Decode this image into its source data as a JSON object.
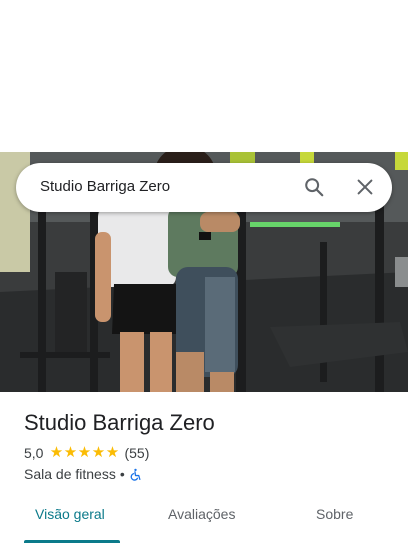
{
  "search": {
    "query": "Studio Barriga Zero"
  },
  "place": {
    "name": "Studio Barriga Zero",
    "rating": "5,0",
    "stars": 5,
    "review_count": "(55)",
    "category": "Sala de fitness",
    "separator": "•"
  },
  "tabs": [
    {
      "label": "Visão geral",
      "active": true
    },
    {
      "label": "Avaliações",
      "active": false
    },
    {
      "label": "Sobre",
      "active": false
    }
  ],
  "colors": {
    "accent": "#0b7a8a",
    "star": "#fbbc04",
    "accessibility": "#1a73e8"
  },
  "icons": {
    "search": "search-icon",
    "close": "close-icon",
    "accessibility": "wheelchair-icon"
  }
}
